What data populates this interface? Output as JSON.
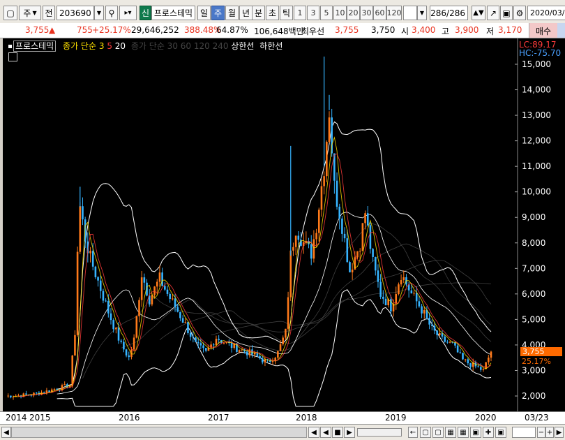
{
  "toolbar": {
    "market_label": "주",
    "prev_label": "전",
    "code": "203690",
    "badge_new": "신",
    "stock_name": "프로스테믹",
    "periods": [
      "일",
      "주",
      "월",
      "년",
      "분",
      "초",
      "틱"
    ],
    "active_period": "주",
    "intervals": [
      "1",
      "3",
      "5",
      "10",
      "20",
      "30",
      "60",
      "120"
    ],
    "count": "286",
    "count_total": "/286",
    "date": "2020/03/"
  },
  "quote": {
    "price": "3,755",
    "arrow": "▲",
    "change": "755",
    "change_pct": "+25.17%",
    "volume": "29,646,252",
    "vol_ratio": "388.48%",
    "turnover": "64.87%",
    "amount": "106,648백만",
    "best_label": "최우선",
    "ask": "3,755",
    "bid": "3,750",
    "open_label": "시",
    "open": "3,400",
    "high_label": "고",
    "high": "3,900",
    "low_label": "저",
    "low": "3,170",
    "buy_label": "매수"
  },
  "chart": {
    "legend_name": "프로스테믹",
    "ma_label": "종가 단순",
    "ma3": "3",
    "ma5": "5",
    "ma20": "20",
    "grey_label": "종가 단순 30 60 120 240",
    "upper_limit_label": "상한선",
    "lower_limit_label": "하한선",
    "lc": "LC:89.17",
    "hc": "HC:-75.70",
    "price_tag": "3,755",
    "pct_tag": "25.17%",
    "colors": {
      "up": "#ff7a1a",
      "down": "#36b4ff",
      "bg": "#000000",
      "ma3": "#ffe100",
      "ma5": "#ff3b3b",
      "ma20": "#3fc46a",
      "band": "#ffffff"
    }
  },
  "chart_data": {
    "type": "candlestick",
    "y_ticks": [
      2000,
      3000,
      4000,
      5000,
      6000,
      7000,
      8000,
      9000,
      10000,
      11000,
      12000,
      13000,
      14000,
      15000
    ],
    "y_tick_labels": [
      "2,000",
      "3,000",
      "4,000",
      "5,000",
      "6,000",
      "7,000",
      "8,000",
      "9,000",
      "10,000",
      "11,000",
      "12,000",
      "13,000",
      "14,000",
      "15,000"
    ],
    "ylim": [
      1500,
      15500
    ],
    "x_labels": [
      "2014",
      "2015",
      "2016",
      "2017",
      "2018",
      "2019",
      "2020",
      "03/23"
    ],
    "close": [
      {
        "t": 0,
        "v": 2000
      },
      {
        "t": 5,
        "v": 2020
      },
      {
        "t": 10,
        "v": 2060
      },
      {
        "t": 15,
        "v": 2160
      },
      {
        "t": 20,
        "v": 2300
      },
      {
        "t": 25,
        "v": 2420
      },
      {
        "t": 27,
        "v": 4500
      },
      {
        "t": 28,
        "v": 7700
      },
      {
        "t": 29,
        "v": 9400
      },
      {
        "t": 31,
        "v": 8200
      },
      {
        "t": 33,
        "v": 7400
      },
      {
        "t": 36,
        "v": 6500
      },
      {
        "t": 40,
        "v": 5300
      },
      {
        "t": 45,
        "v": 4000
      },
      {
        "t": 48,
        "v": 3500
      },
      {
        "t": 50,
        "v": 4200
      },
      {
        "t": 53,
        "v": 6800
      },
      {
        "t": 56,
        "v": 5800
      },
      {
        "t": 60,
        "v": 6600
      },
      {
        "t": 63,
        "v": 6000
      },
      {
        "t": 66,
        "v": 5500
      },
      {
        "t": 70,
        "v": 4800
      },
      {
        "t": 74,
        "v": 4000
      },
      {
        "t": 78,
        "v": 3700
      },
      {
        "t": 82,
        "v": 4300
      },
      {
        "t": 87,
        "v": 4000
      },
      {
        "t": 92,
        "v": 3800
      },
      {
        "t": 97,
        "v": 3600
      },
      {
        "t": 102,
        "v": 3300
      },
      {
        "t": 106,
        "v": 3700
      },
      {
        "t": 109,
        "v": 4500
      },
      {
        "t": 111,
        "v": 7500
      },
      {
        "t": 113,
        "v": 8600
      },
      {
        "t": 116,
        "v": 8000
      },
      {
        "t": 119,
        "v": 7600
      },
      {
        "t": 121,
        "v": 8700
      },
      {
        "t": 124,
        "v": 11000
      },
      {
        "t": 126,
        "v": 13200
      },
      {
        "t": 128,
        "v": 10200
      },
      {
        "t": 131,
        "v": 8700
      },
      {
        "t": 134,
        "v": 6900
      },
      {
        "t": 138,
        "v": 8000
      },
      {
        "t": 140,
        "v": 9200
      },
      {
        "t": 143,
        "v": 7200
      },
      {
        "t": 146,
        "v": 6000
      },
      {
        "t": 150,
        "v": 5500
      },
      {
        "t": 154,
        "v": 6800
      },
      {
        "t": 158,
        "v": 6000
      },
      {
        "t": 162,
        "v": 5400
      },
      {
        "t": 166,
        "v": 4600
      },
      {
        "t": 170,
        "v": 4200
      },
      {
        "t": 174,
        "v": 4000
      },
      {
        "t": 178,
        "v": 3400
      },
      {
        "t": 182,
        "v": 3200
      },
      {
        "t": 186,
        "v": 3000
      },
      {
        "t": 189,
        "v": 3755
      }
    ]
  },
  "scrollbar": {
    "count": "286"
  }
}
